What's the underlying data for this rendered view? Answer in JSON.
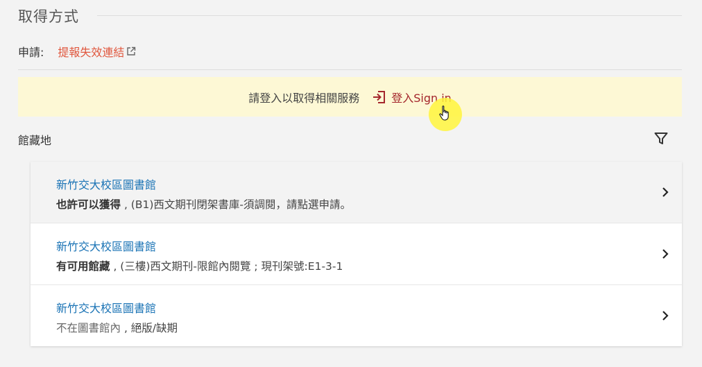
{
  "section": {
    "title": "取得方式"
  },
  "request": {
    "label": "申請:",
    "link_text": "提報失效連結"
  },
  "signin": {
    "prompt": "請登入以取得相關服務",
    "link_text": "登入Sign in"
  },
  "holdings": {
    "header": "館藏地",
    "items": [
      {
        "library": "新竹交大校區圖書館",
        "status_strong": "也許可以獲得",
        "status_plain": "",
        "detail": " , (B1)西文期刊閉架書庫-須調閱，請點選申請。"
      },
      {
        "library": "新竹交大校區圖書館",
        "status_strong": "有可用館藏",
        "status_plain": "",
        "detail": " , (三樓)西文期刊-限館內閱覽 ; 現刊架號:E1-3-1"
      },
      {
        "library": "新竹交大校區圖書館",
        "status_strong": "",
        "status_plain": "不在圖書館內",
        "detail": " , 絕版/缺期"
      }
    ]
  },
  "colors": {
    "link": "#e0573e",
    "library_name": "#1a73b5",
    "signin": "#a4262c",
    "banner": "#fdf8d5"
  }
}
